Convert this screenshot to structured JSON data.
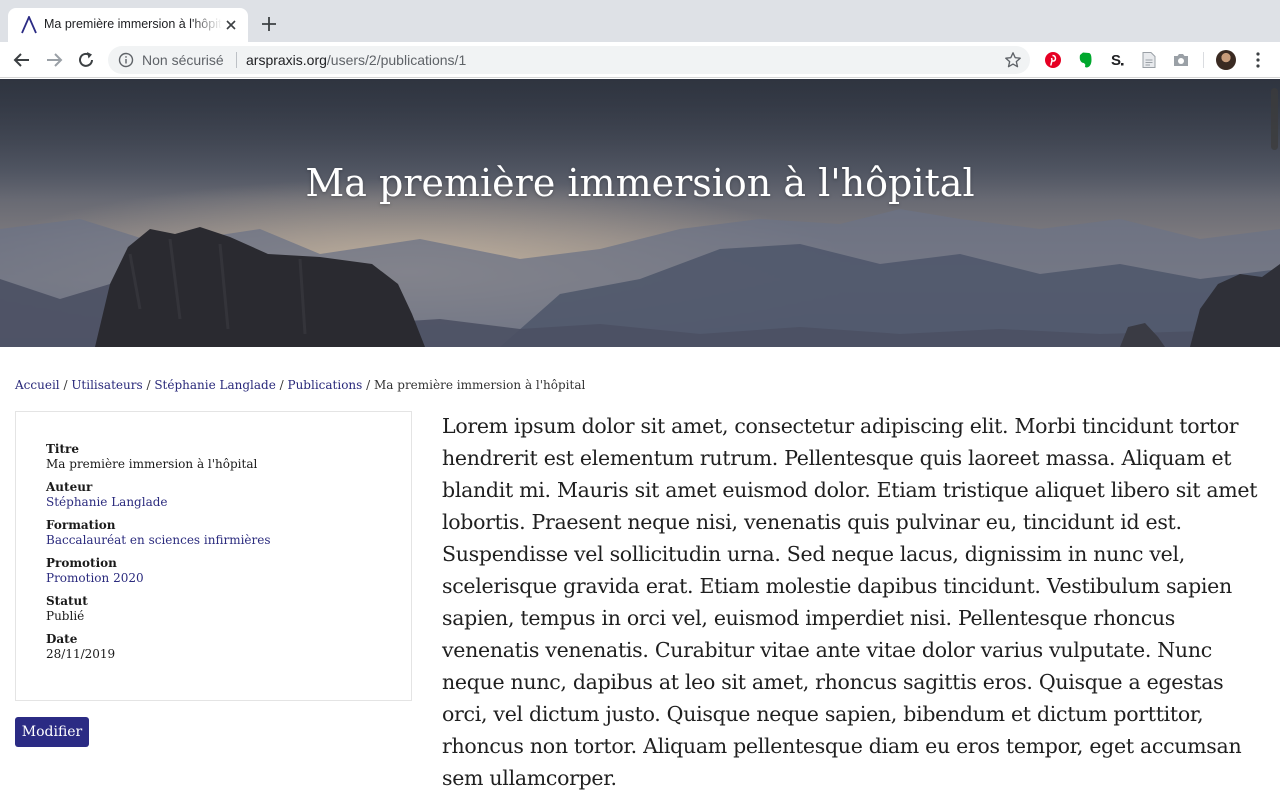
{
  "browser": {
    "tab": {
      "title": "Ma première immersion à l'hôpital"
    },
    "omnibox": {
      "security_label": "Non sécurisé",
      "host": "arspraxis.org",
      "path": "/users/2/publications/1"
    },
    "extensions": [
      "pinterest-icon",
      "evernote-icon",
      "dollar-s-icon",
      "document-icon",
      "camera-icon"
    ]
  },
  "hero": {
    "title": "Ma première immersion à l'hôpital"
  },
  "breadcrumb": [
    {
      "label": "Accueil"
    },
    {
      "label": "Utilisateurs"
    },
    {
      "label": "Stéphanie Langlade"
    },
    {
      "label": "Publications"
    },
    {
      "label": "Ma première immersion à l'hôpital"
    }
  ],
  "details": {
    "title": {
      "label": "Titre",
      "value": "Ma première immersion à l'hôpital"
    },
    "author": {
      "label": "Auteur",
      "value": "Stéphanie Langlade"
    },
    "program": {
      "label": "Formation",
      "value": "Baccalauréat en sciences infirmières"
    },
    "cohort": {
      "label": "Promotion",
      "value": "Promotion 2020"
    },
    "status": {
      "label": "Statut",
      "value": "Publié"
    },
    "date": {
      "label": "Date",
      "value": "28/11/2019"
    }
  },
  "actions": {
    "edit_label": "Modifier"
  },
  "content": {
    "body": "Lorem ipsum dolor sit amet, consectetur adipiscing elit. Morbi tincidunt tortor hendrerit est elementum rutrum. Pellentesque quis laoreet massa. Aliquam et blandit mi. Mauris sit amet euismod dolor. Etiam tristique aliquet libero sit amet lobortis. Praesent neque nisi, venenatis quis pulvinar eu, tincidunt id est. Suspendisse vel sollicitudin urna. Sed neque lacus, dignissim in nunc vel, scelerisque gravida erat. Etiam molestie dapibus tincidunt. Vestibulum sapien sapien, tempus in orci vel, euismod imperdiet nisi. Pellentesque rhoncus venenatis venenatis. Curabitur vitae ante vitae dolor varius vulputate. Nunc neque nunc, dapibus at leo sit amet, rhoncus sagittis eros. Quisque a egestas orci, vel dictum justo. Quisque neque sapien, bibendum et dictum porttitor, rhoncus non tortor. Aliquam pellentesque diam eu eros tempor, eget accumsan sem ullamcorper."
  },
  "colors": {
    "accent": "#2b2b84",
    "link": "#28287a"
  }
}
